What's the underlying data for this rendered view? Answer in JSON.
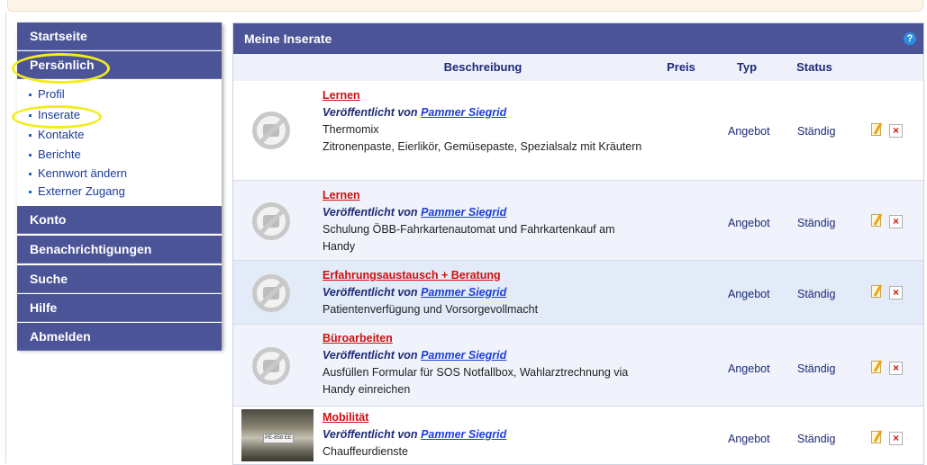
{
  "sidebar": {
    "startseite": "Startseite",
    "persoenlich": "Persönlich",
    "sub_items": [
      "Profil",
      "Inserate",
      "Kontakte",
      "Berichte",
      "Kennwort ändern",
      "Externer Zugang"
    ],
    "konto": "Konto",
    "benachrichtigungen": "Benachrichtigungen",
    "suche": "Suche",
    "hilfe": "Hilfe",
    "abmelden": "Abmelden"
  },
  "main": {
    "title": "Meine Inserate",
    "help_icon": "?",
    "columns": {
      "beschreibung": "Beschreibung",
      "preis": "Preis",
      "typ": "Typ",
      "status": "Status"
    },
    "rows": [
      {
        "category": "Lernen",
        "published_prefix": "Veröffentlicht von",
        "author": "Pammer Siegrid",
        "title": "Thermomix",
        "detail": "Zitronenpaste, Eierlikör, Gemüsepaste, Spezialsalz mit Kräutern",
        "typ": "Angebot",
        "status": "Ständig",
        "image": "no-image-icon"
      },
      {
        "category": "Lernen",
        "published_prefix": "Veröffentlicht von",
        "author": "Pammer Siegrid",
        "title": "Schulung ÖBB-Fahrkartenautomat und Fahrkartenkauf am Handy",
        "detail": "",
        "typ": "Angebot",
        "status": "Ständig",
        "image": "no-image-icon"
      },
      {
        "category": "Erfahrungsaustausch + Beratung",
        "published_prefix": "Veröffentlicht von",
        "author": "Pammer Siegrid",
        "title": "Patientenverfügung und Vorsorgevollmacht",
        "detail": "",
        "typ": "Angebot",
        "status": "Ständig",
        "image": "no-image-icon"
      },
      {
        "category": "Büroarbeiten",
        "published_prefix": "Veröffentlicht von",
        "author": "Pammer Siegrid",
        "title": "Ausfüllen Formular für SOS Notfallbox, Wahlarztrechnung via Handy einreichen",
        "detail": "",
        "typ": "Angebot",
        "status": "Ständig",
        "image": "no-image-icon"
      },
      {
        "category": "Mobilität",
        "published_prefix": "Veröffentlicht von",
        "author": "Pammer Siegrid",
        "title": "Chauffeurdienste",
        "detail": "",
        "typ": "Angebot",
        "status": "Ständig",
        "image": "car-photo",
        "plate": "PE-858 EE"
      }
    ]
  },
  "colors": {
    "nav": "#4b5497",
    "highlight": "#f4ec1f",
    "category": "#cc1111",
    "link": "#1d3fd8"
  }
}
